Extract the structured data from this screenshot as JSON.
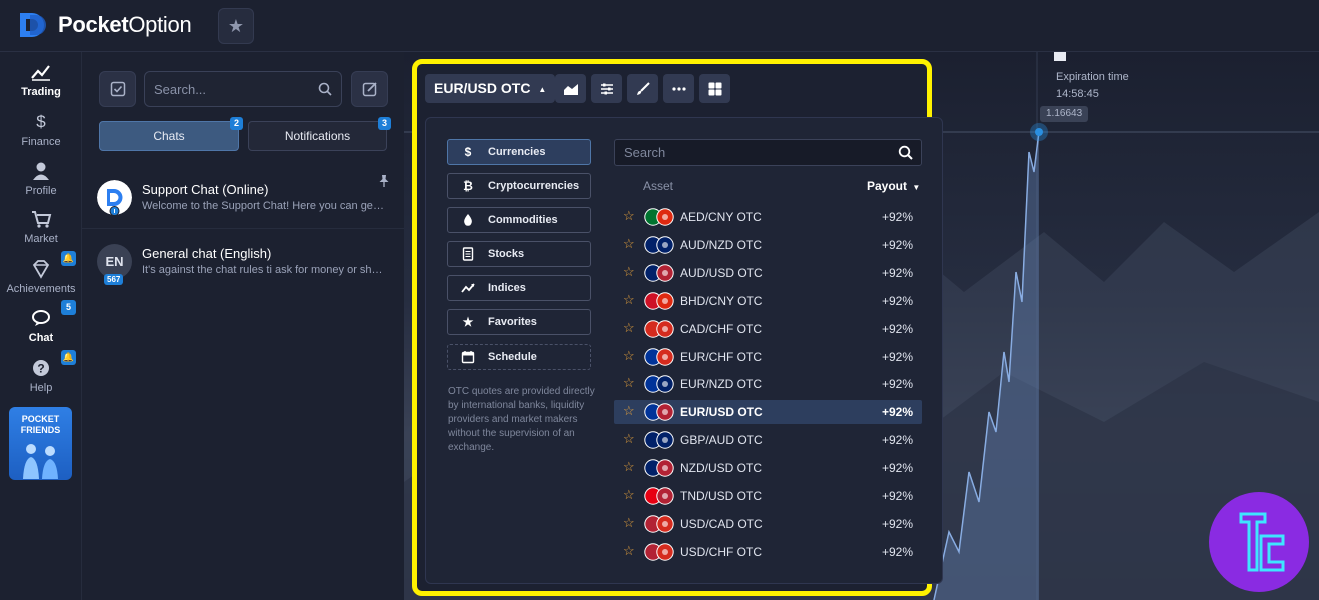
{
  "app": {
    "brand_bold": "Pocket",
    "brand_rest": "Option"
  },
  "nav": [
    {
      "label": "Trading",
      "icon": "chart-line-icon",
      "active": true
    },
    {
      "label": "Finance",
      "icon": "dollar-icon"
    },
    {
      "label": "Profile",
      "icon": "user-icon"
    },
    {
      "label": "Market",
      "icon": "cart-icon"
    },
    {
      "label": "Achievements",
      "icon": "diamond-icon",
      "badge": "bell"
    },
    {
      "label": "Chat",
      "icon": "chat-icon",
      "badge": "5"
    },
    {
      "label": "Help",
      "icon": "help-icon",
      "badge": "bell"
    }
  ],
  "promo": {
    "line1": "POCKET",
    "line2": "FRIENDS"
  },
  "chat": {
    "search_placeholder": "Search...",
    "tabs": [
      {
        "label": "Chats",
        "badge": "2"
      },
      {
        "label": "Notifications",
        "badge": "3"
      }
    ],
    "items": [
      {
        "title": "Support Chat (Online)",
        "preview": "Welcome to the Support Chat! Here you can get help",
        "avatar": "support"
      },
      {
        "title": "General chat (English)",
        "preview": "It's against the chat rules ti ask for money or share",
        "avatar_text": "EN",
        "avatar_badge": "567"
      }
    ]
  },
  "toolbar": {
    "pair_label": "EUR/USD OTC"
  },
  "dropdown": {
    "categories": [
      {
        "label": "Currencies",
        "icon": "dollar-icon",
        "active": true
      },
      {
        "label": "Cryptocurrencies",
        "icon": "bitcoin-icon"
      },
      {
        "label": "Commodities",
        "icon": "drop-icon"
      },
      {
        "label": "Stocks",
        "icon": "document-icon"
      },
      {
        "label": "Indices",
        "icon": "trend-icon"
      },
      {
        "label": "Favorites",
        "icon": "star-icon"
      },
      {
        "label": "Schedule",
        "icon": "calendar-icon"
      }
    ],
    "note": "OTC quotes are provided directly by international banks, liquidity providers and market makers without the supervision of an exchange.",
    "search_placeholder": "Search",
    "col_asset": "Asset",
    "col_payout": "Payout",
    "assets": [
      {
        "pair": "AED/CNY OTC",
        "payout": "+92%",
        "f1": "#00732f",
        "f2": "#de2910"
      },
      {
        "pair": "AUD/NZD OTC",
        "payout": "+92%",
        "f1": "#012169",
        "f2": "#012169"
      },
      {
        "pair": "AUD/USD OTC",
        "payout": "+92%",
        "f1": "#012169",
        "f2": "#b22234"
      },
      {
        "pair": "BHD/CNY OTC",
        "payout": "+92%",
        "f1": "#ce1126",
        "f2": "#de2910"
      },
      {
        "pair": "CAD/CHF OTC",
        "payout": "+92%",
        "f1": "#d52b1e",
        "f2": "#d52b1e"
      },
      {
        "pair": "EUR/CHF OTC",
        "payout": "+92%",
        "f1": "#003399",
        "f2": "#d52b1e"
      },
      {
        "pair": "EUR/NZD OTC",
        "payout": "+92%",
        "f1": "#003399",
        "f2": "#012169"
      },
      {
        "pair": "EUR/USD OTC",
        "payout": "+92%",
        "f1": "#003399",
        "f2": "#b22234",
        "selected": true
      },
      {
        "pair": "GBP/AUD OTC",
        "payout": "+92%",
        "f1": "#012169",
        "f2": "#012169"
      },
      {
        "pair": "NZD/USD OTC",
        "payout": "+92%",
        "f1": "#012169",
        "f2": "#b22234"
      },
      {
        "pair": "TND/USD OTC",
        "payout": "+92%",
        "f1": "#e70013",
        "f2": "#b22234"
      },
      {
        "pair": "USD/CAD OTC",
        "payout": "+92%",
        "f1": "#b22234",
        "f2": "#d52b1e"
      },
      {
        "pair": "USD/CHF OTC",
        "payout": "+92%",
        "f1": "#b22234",
        "f2": "#d52b1e"
      }
    ]
  },
  "chart_overlay": {
    "expiration_label": "Expiration time",
    "expiration_time": "14:58:45",
    "price": "1.16643"
  },
  "colors": {
    "accent": "#1e7fd8",
    "highlight_frame": "#fff200",
    "star": "#e6a23c",
    "badge_purple": "#8a2be2"
  }
}
